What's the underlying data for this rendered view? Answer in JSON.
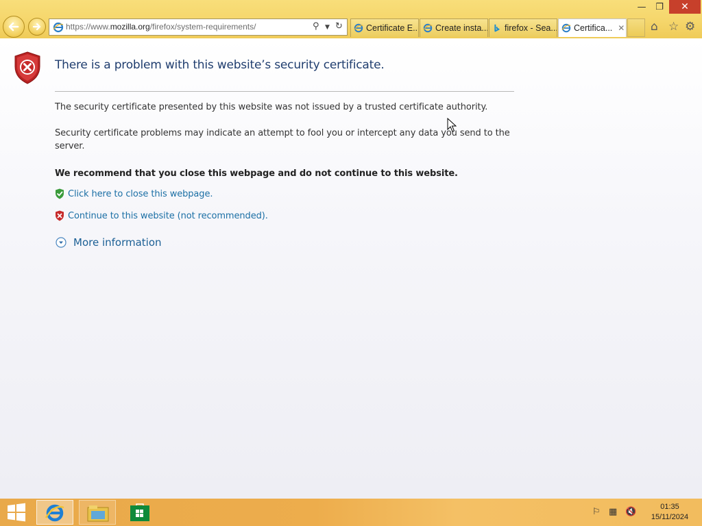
{
  "window": {
    "minimize_label": "—",
    "maximize_label": "❐",
    "close_label": "✕"
  },
  "address": {
    "prefix": "https://www.",
    "domain": "mozilla.org",
    "path": "/firefox/system-requirements/"
  },
  "tabs": [
    {
      "label": "Certificate E...",
      "icon": "ie-icon",
      "active": false
    },
    {
      "label": "Create insta...",
      "icon": "ie-icon",
      "active": false
    },
    {
      "label": "firefox - Sea...",
      "icon": "bing-icon",
      "active": false
    },
    {
      "label": "Certifica...",
      "icon": "ie-icon",
      "active": true
    }
  ],
  "active_tab_close": "✕",
  "page": {
    "headline": "There is a problem with this website’s security certificate.",
    "paragraph1": "The security certificate presented by this website was not issued by a trusted certificate authority.",
    "paragraph2": "Security certificate problems may indicate an attempt to fool you or intercept any data you send to the server.",
    "recommendation": "We recommend that you close this webpage and do not continue to this website.",
    "close_link": "Click here to close this webpage.",
    "continue_link": "Continue to this website (not recommended).",
    "more_info": "More information"
  },
  "taskbar": {
    "time": "01:35",
    "date": "15/11/2024"
  },
  "colors": {
    "accent": "#f5d66b",
    "headline": "#1f3d6e",
    "link": "#1b6fa5",
    "error_red": "#c7402b",
    "shield_green": "#3b9b3b"
  }
}
